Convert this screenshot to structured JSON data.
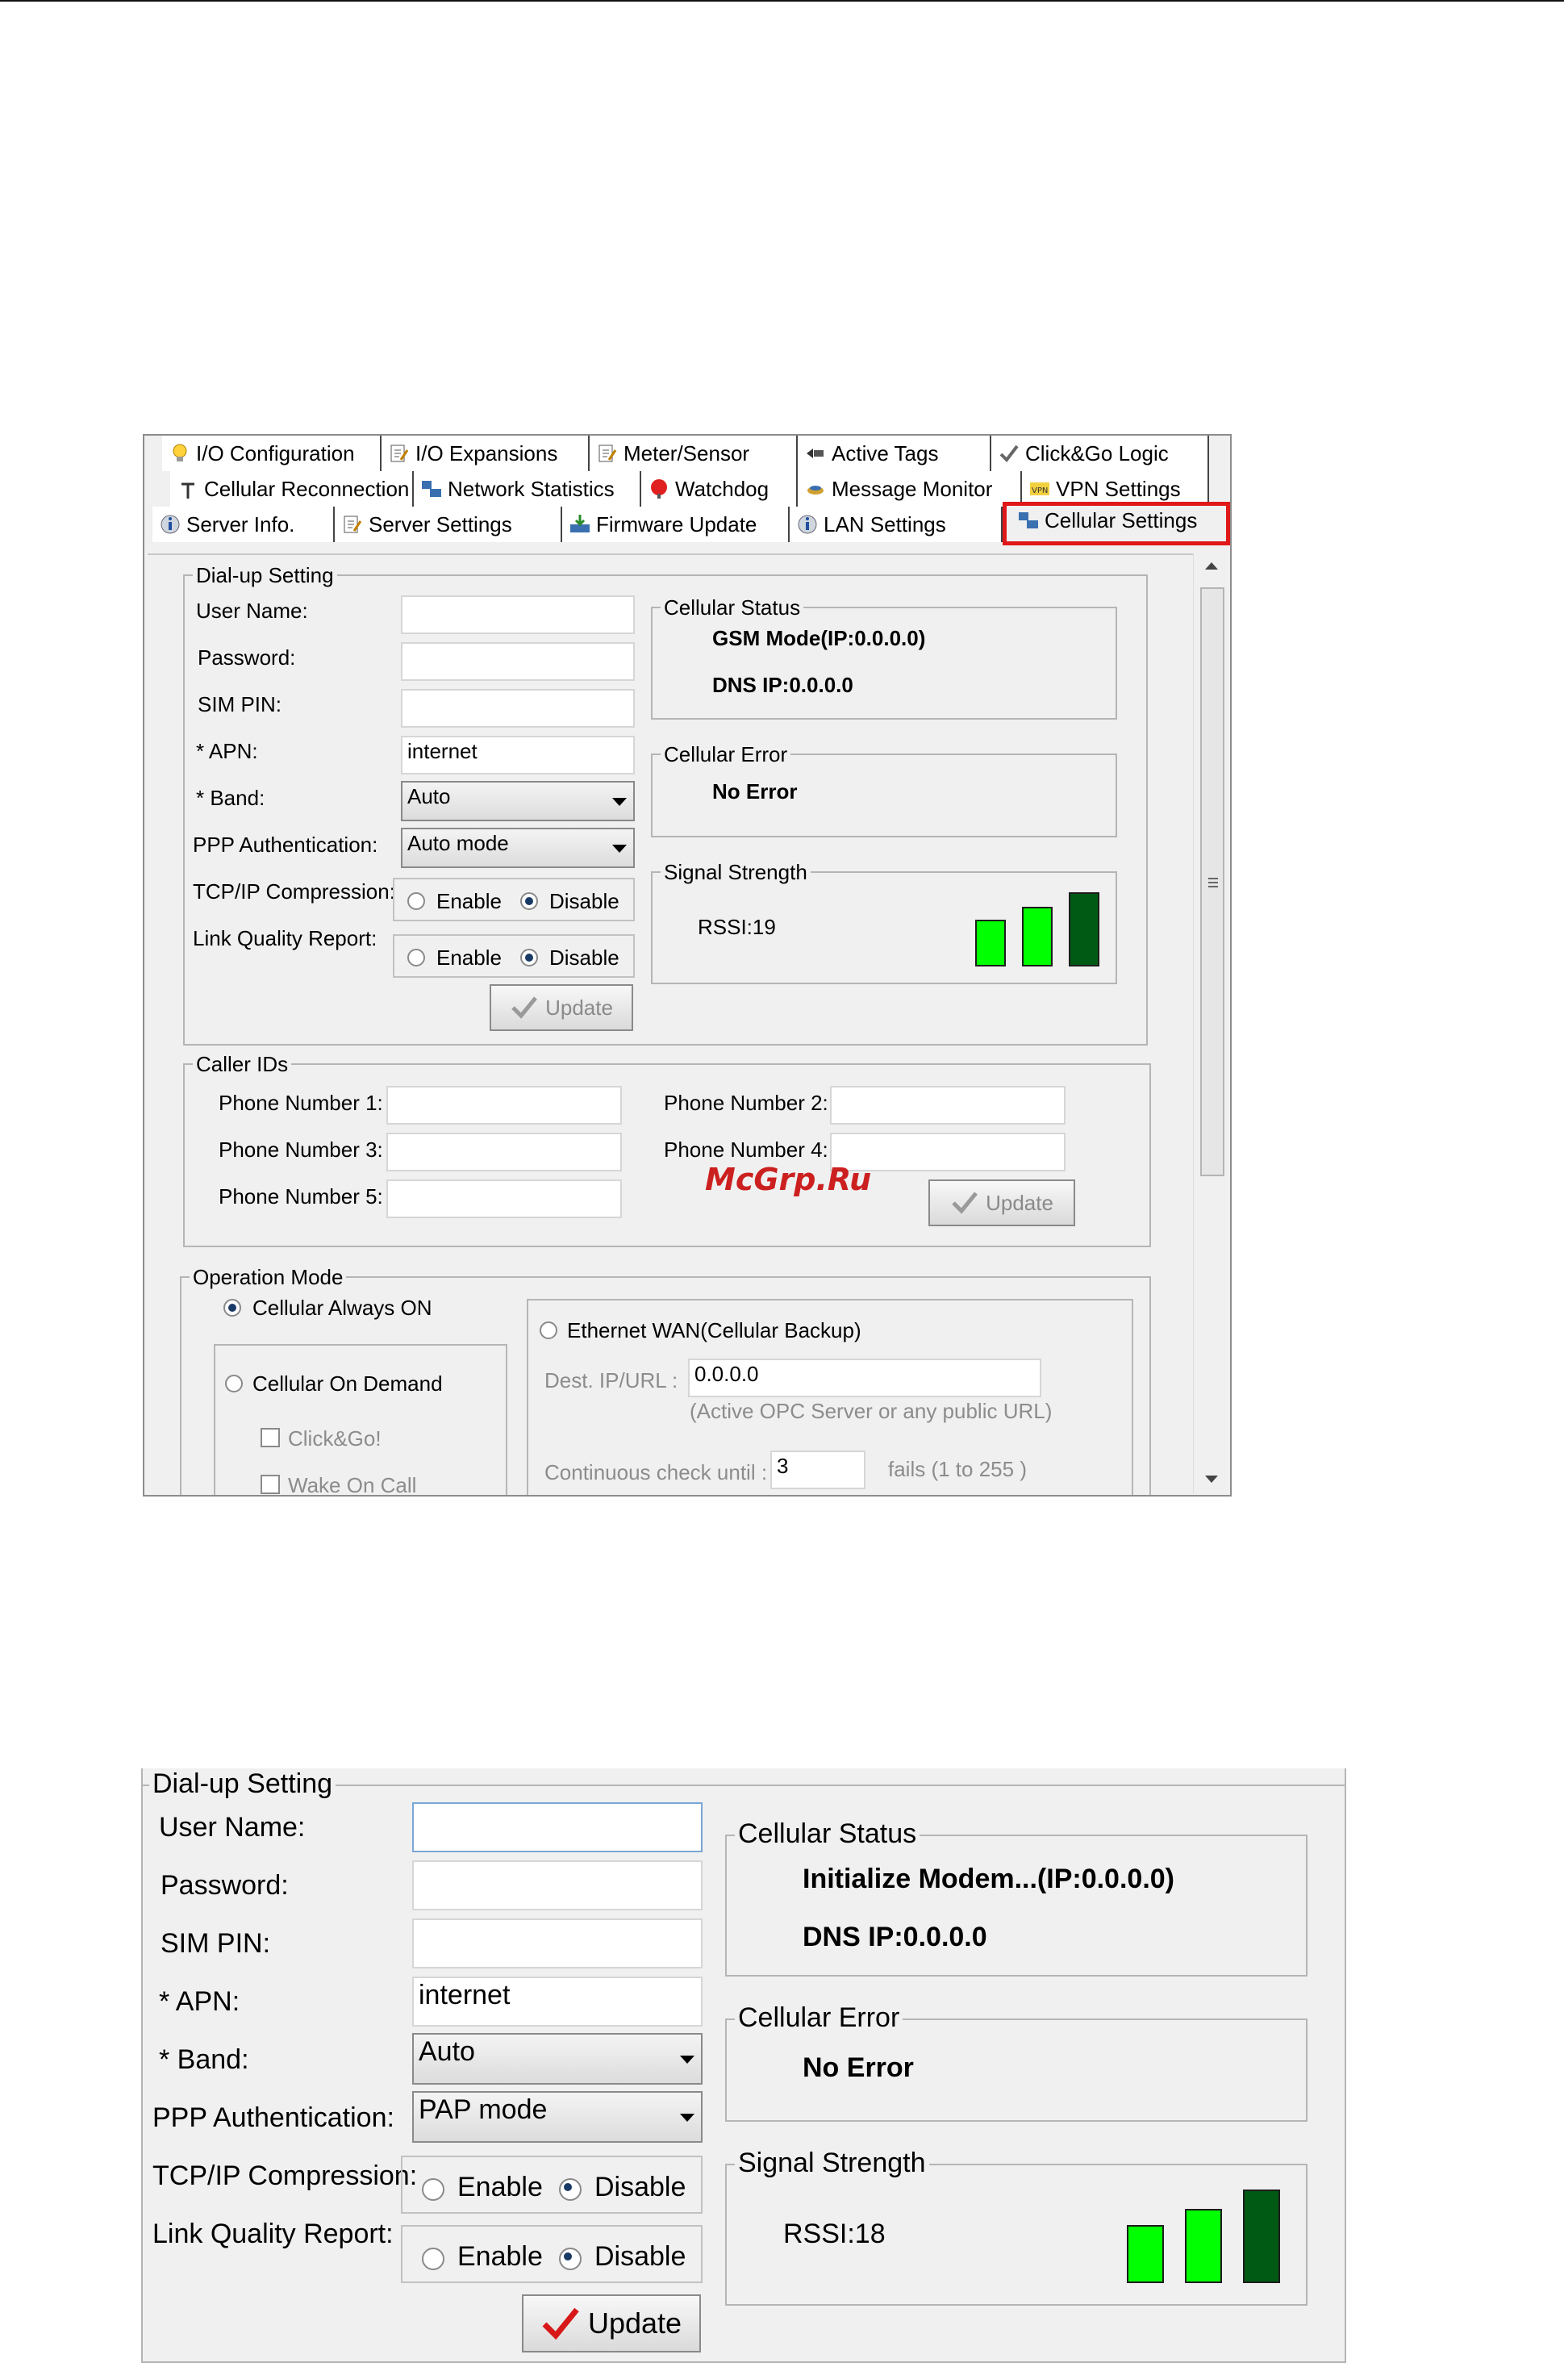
{
  "tabs": {
    "row1": [
      {
        "label": "I/O Configuration",
        "icon": "lightbulb-icon"
      },
      {
        "label": "I/O Expansions",
        "icon": "notepad-icon"
      },
      {
        "label": "Meter/Sensor",
        "icon": "notepad-icon"
      },
      {
        "label": "Active Tags",
        "icon": "tags-icon"
      },
      {
        "label": "Click&Go Logic",
        "icon": "checkmark-logic-icon"
      }
    ],
    "row2": [
      {
        "label": "Cellular Reconnection",
        "icon": "antenna-icon"
      },
      {
        "label": "Network Statistics",
        "icon": "network-icon"
      },
      {
        "label": "Watchdog",
        "icon": "watchdog-icon"
      },
      {
        "label": "Message Monitor",
        "icon": "message-icon"
      },
      {
        "label": "VPN Settings",
        "icon": "vpn-icon"
      }
    ],
    "row3": [
      {
        "label": "Server Info.",
        "icon": "info-icon"
      },
      {
        "label": "Server Settings",
        "icon": "notepad-icon"
      },
      {
        "label": "Firmware Update",
        "icon": "firmware-icon"
      },
      {
        "label": "LAN Settings",
        "icon": "info-icon"
      },
      {
        "label": "Cellular Settings",
        "icon": "network-icon"
      }
    ]
  },
  "shot1": {
    "dialup": {
      "legend": "Dial-up Setting",
      "user_name_label": "User Name:",
      "password_label": "Password:",
      "sim_pin_label": "SIM PIN:",
      "apn_label": "* APN:",
      "apn_value": "internet",
      "band_label": "* Band:",
      "band_value": "Auto",
      "ppp_label": "PPP Authentication:",
      "ppp_value": "Auto mode",
      "tcp_label": "TCP/IP Compression:",
      "lqr_label": "Link Quality Report:",
      "enable": "Enable",
      "disable": "Disable",
      "update": "Update"
    },
    "cellular_status": {
      "legend": "Cellular Status",
      "mode": "GSM Mode(IP:0.0.0.0)",
      "dns": "DNS IP:0.0.0.0"
    },
    "cellular_error": {
      "legend": "Cellular Error",
      "value": "No Error"
    },
    "signal": {
      "legend": "Signal Strength",
      "rssi": "RSSI:19"
    },
    "caller_ids": {
      "legend": "Caller IDs",
      "p1": "Phone Number 1:",
      "p2": "Phone Number 2:",
      "p3": "Phone Number 3:",
      "p4": "Phone Number 4:",
      "p5": "Phone Number 5:",
      "update": "Update"
    },
    "operation_mode": {
      "legend": "Operation Mode",
      "always_on": "Cellular Always ON",
      "on_demand": "Cellular On Demand",
      "clickgo": "Click&Go!",
      "wake": "Wake On Call",
      "ethernet_wan": "Ethernet WAN(Cellular Backup)",
      "dest_label": "Dest. IP/URL :",
      "dest_value": "0.0.0.0",
      "dest_hint": "(Active OPC Server or any public URL)",
      "check_label": "Continuous check until :",
      "check_value": "3",
      "check_suffix": "fails (1 to 255 )"
    }
  },
  "watermark": "McGrp.Ru",
  "shot2": {
    "dialup": {
      "legend": "Dial-up Setting",
      "user_name_label": "User Name:",
      "password_label": "Password:",
      "sim_pin_label": "SIM PIN:",
      "apn_label": "* APN:",
      "apn_value": "internet",
      "band_label": "* Band:",
      "band_value": "Auto",
      "ppp_label": "PPP Authentication:",
      "ppp_value": "PAP mode",
      "tcp_label": "TCP/IP Compression:",
      "lqr_label": "Link Quality Report:",
      "enable": "Enable",
      "disable": "Disable",
      "update": "Update"
    },
    "cellular_status": {
      "legend": "Cellular Status",
      "mode": "Initialize Modem...(IP:0.0.0.0)",
      "dns": "DNS IP:0.0.0.0"
    },
    "cellular_error": {
      "legend": "Cellular Error",
      "value": "No Error"
    },
    "signal": {
      "legend": "Signal Strength",
      "rssi": "RSSI:18"
    }
  },
  "colors": {
    "bar_light": "#00ff00",
    "bar_dark": "#005a14",
    "highlight": "#e01818"
  }
}
